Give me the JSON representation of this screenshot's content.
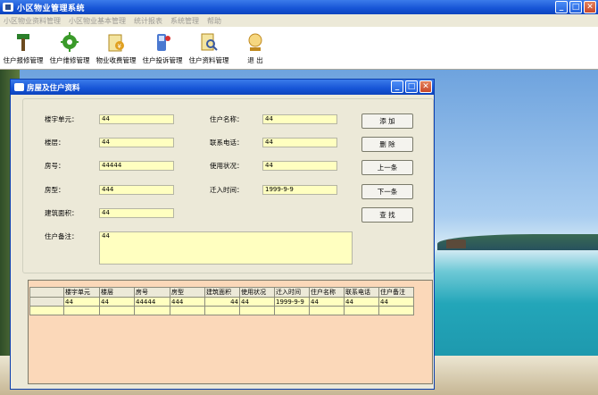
{
  "app": {
    "title": "小区物业管理系统"
  },
  "menu": [
    "小区物业资料管理",
    "小区物业基本管理",
    "统计报表",
    "系统管理",
    "帮助"
  ],
  "toolbar": [
    {
      "label": "住户报修管理",
      "icon": "hammer-icon",
      "color": "#2a7f2a"
    },
    {
      "label": "住户维修管理",
      "icon": "gear-icon",
      "color": "#3a9a2a"
    },
    {
      "label": "物业收费管理",
      "icon": "money-icon",
      "color": "#e0a020"
    },
    {
      "label": "住户投诉管理",
      "icon": "phone-icon",
      "color": "#4a78d0"
    },
    {
      "label": "住户资料管理",
      "icon": "search-document-icon",
      "color": "#d8a020"
    },
    {
      "label": "退  出",
      "icon": "exit-icon",
      "color": "#e0a020"
    }
  ],
  "child": {
    "title": "房屋及住户资料",
    "fields": {
      "building_unit_label": "楼宇单元：",
      "building_unit": "44",
      "floor_label": "楼层：",
      "floor": "44",
      "room_label": "房号：",
      "room": "44444",
      "type_label": "房型：",
      "type": "444",
      "area_label": "建筑面积：",
      "area": "44",
      "owner_label": "住户名称：",
      "owner": "44",
      "phone_label": "联系电话：",
      "phone": "44",
      "status_label": "使用状况：",
      "status": "44",
      "movein_label": "迁入时间：",
      "movein": "1999-9-9",
      "note_label": "住户备注：",
      "note": "44"
    },
    "buttons": {
      "add": "添  加",
      "delete": "删  除",
      "prev": "上一条",
      "next": "下一条",
      "find": "查  找"
    },
    "grid": {
      "headers": [
        "楼宇单元",
        "楼层",
        "房号",
        "房型",
        "建筑面积",
        "使用状况",
        "迁入时间",
        "住户名称",
        "联系电话",
        "住户备注"
      ],
      "rows": [
        [
          "44",
          "44",
          "44444",
          "444",
          "44",
          "44",
          "1999-9-9",
          "44",
          "44",
          "44"
        ]
      ]
    }
  }
}
